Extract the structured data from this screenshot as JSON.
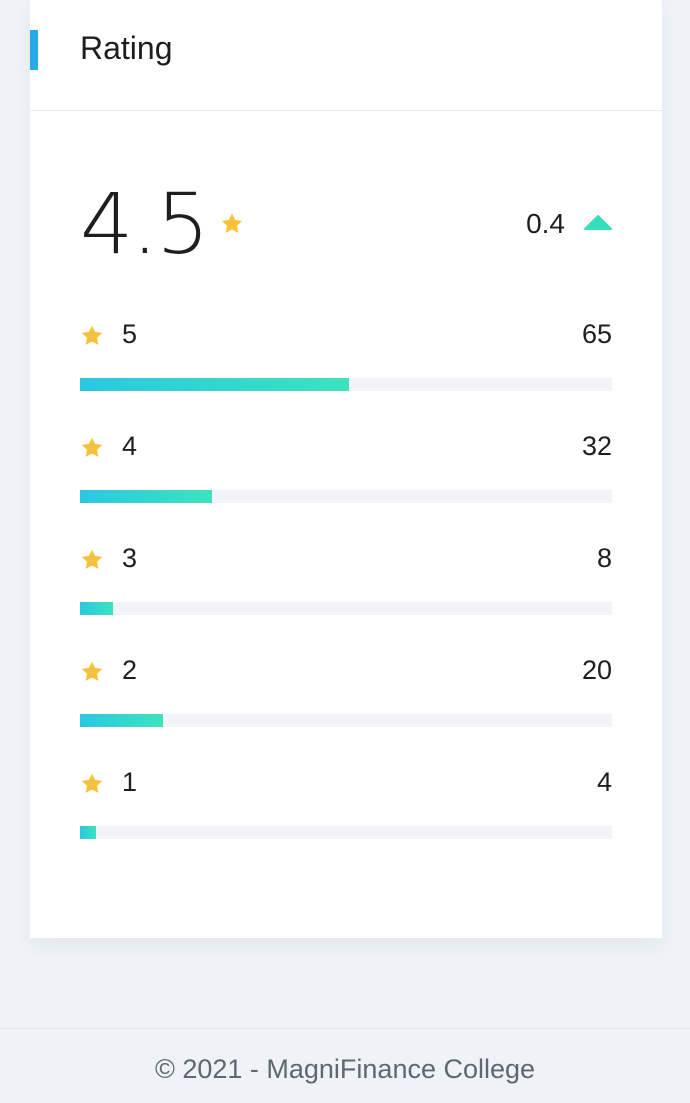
{
  "card": {
    "title": "Rating",
    "accent_color": "#27a9ea"
  },
  "summary": {
    "average": "4.5",
    "average_icon": "star-icon",
    "trend_value": "0.4",
    "trend_icon": "triangle-up-icon",
    "trend_color": "#36dfba"
  },
  "breakdown": [
    {
      "stars": "5",
      "count": "65",
      "fill_fraction": 0.505
    },
    {
      "stars": "4",
      "count": "32",
      "fill_fraction": 0.249
    },
    {
      "stars": "3",
      "count": "8",
      "fill_fraction": 0.062
    },
    {
      "stars": "2",
      "count": "20",
      "fill_fraction": 0.156
    },
    {
      "stars": "1",
      "count": "4",
      "fill_fraction": 0.031
    }
  ],
  "colors": {
    "star": "#f8c13a",
    "bar_gradient_start": "#2cc7e3",
    "bar_gradient_end": "#3be3bd",
    "track": "#f1f5f9"
  },
  "footer": {
    "text": "© 2021 - MagniFinance College"
  }
}
